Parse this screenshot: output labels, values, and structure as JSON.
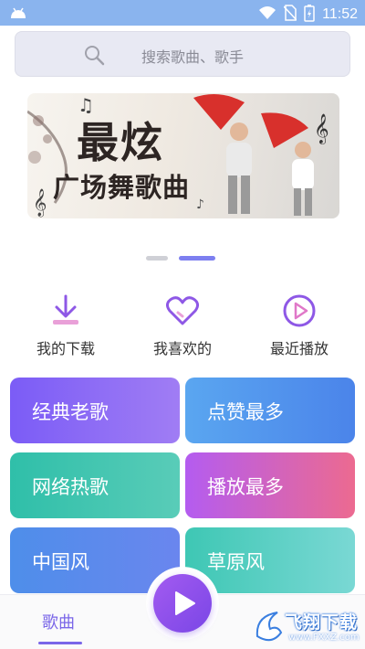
{
  "status_bar": {
    "time": "11:52",
    "icons": [
      "android-icon",
      "wifi-icon",
      "no-sim-icon",
      "battery-charging-icon"
    ]
  },
  "search": {
    "placeholder": "搜索歌曲、歌手"
  },
  "banner": {
    "title_line1": "最炫",
    "title_line2": "广场舞歌曲"
  },
  "carousel": {
    "page_count": 2,
    "active_index": 1
  },
  "quick_actions": [
    {
      "label": "我的下载",
      "icon": "download-icon"
    },
    {
      "label": "我喜欢的",
      "icon": "heart-icon"
    },
    {
      "label": "最近播放",
      "icon": "play-circle-icon"
    }
  ],
  "categories": [
    {
      "label": "经典老歌"
    },
    {
      "label": "点赞最多"
    },
    {
      "label": "网络热歌"
    },
    {
      "label": "播放最多"
    },
    {
      "label": "中国风"
    },
    {
      "label": "草原风"
    }
  ],
  "tab_bar": {
    "songs_label": "歌曲",
    "play_icon": "play-icon"
  },
  "watermark": {
    "text": "飞翔下载",
    "url": "www.FXXZ.com"
  },
  "colors": {
    "status_bar": "#8ab4ee",
    "accent": "#7a66e8",
    "icon_purple": "#8e58e6"
  }
}
